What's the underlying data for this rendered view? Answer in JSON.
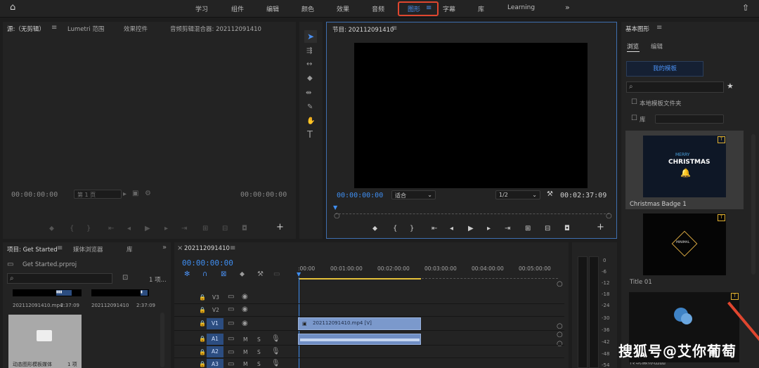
{
  "topbar": {
    "workspaces": [
      "学习",
      "组件",
      "编辑",
      "颜色",
      "效果",
      "音频",
      "图形",
      "字幕",
      "库",
      "Learning"
    ],
    "active": "图形",
    "more": "»"
  },
  "source_panel": {
    "tabs": [
      "源:（无剪辑）",
      "Lumetri 范围",
      "效果控件",
      "音频剪辑混合器: 202112091410"
    ],
    "timecode_left": "00:00:00:00",
    "timecode_right": "00:00:00:00",
    "page_select": "第 1 页"
  },
  "program_panel": {
    "title": "节目: 202112091410",
    "timecode": "00:00:00:00",
    "fit": "适合",
    "quality": "1/2",
    "duration": "00:02:37:09"
  },
  "graphics_panel": {
    "title": "基本图形",
    "tabs": [
      "浏览",
      "编辑"
    ],
    "my_templates": "我的模板",
    "local_folder": "本地模板文件夹",
    "library": "库",
    "templates": [
      {
        "name": "Christmas Badge 1",
        "text1": "MERRY",
        "text2": "CHRISTMAS"
      },
      {
        "name": "Title 01",
        "text1": "MINIMAL",
        "text2": ""
      },
      {
        "name": "传统徽标出品"
      }
    ]
  },
  "project_panel": {
    "tabs": [
      "项目: Get Started",
      "媒体浏览器",
      "库"
    ],
    "file": "Get Started.prproj",
    "count": "1 项...",
    "items": [
      {
        "name": "202112091410.mp4",
        "duration": "2:37:09"
      },
      {
        "name": "202112091410",
        "duration": "2:37:09"
      },
      {
        "name": "动态图形模板媒体",
        "duration": "1 项"
      }
    ]
  },
  "timeline": {
    "tab": "202112091410",
    "timecode": "00:00:00:00",
    "ruler": [
      ":00:00",
      "00:01:00:00",
      "00:02:00:00",
      "00:03:00:00",
      "00:04:00:00",
      "00:05:00:00"
    ],
    "video_tracks": [
      "V3",
      "V2",
      "V1"
    ],
    "audio_tracks": [
      "A1",
      "A2",
      "A3"
    ],
    "clip_name": "202112091410.mp4 [V]",
    "m": "M",
    "s": "S"
  },
  "meter": {
    "labels": [
      "0",
      "-6",
      "-12",
      "-18",
      "-24",
      "-30",
      "-36",
      "-42",
      "-48",
      "-54"
    ]
  },
  "watermark": "搜狐号@艾你葡萄"
}
